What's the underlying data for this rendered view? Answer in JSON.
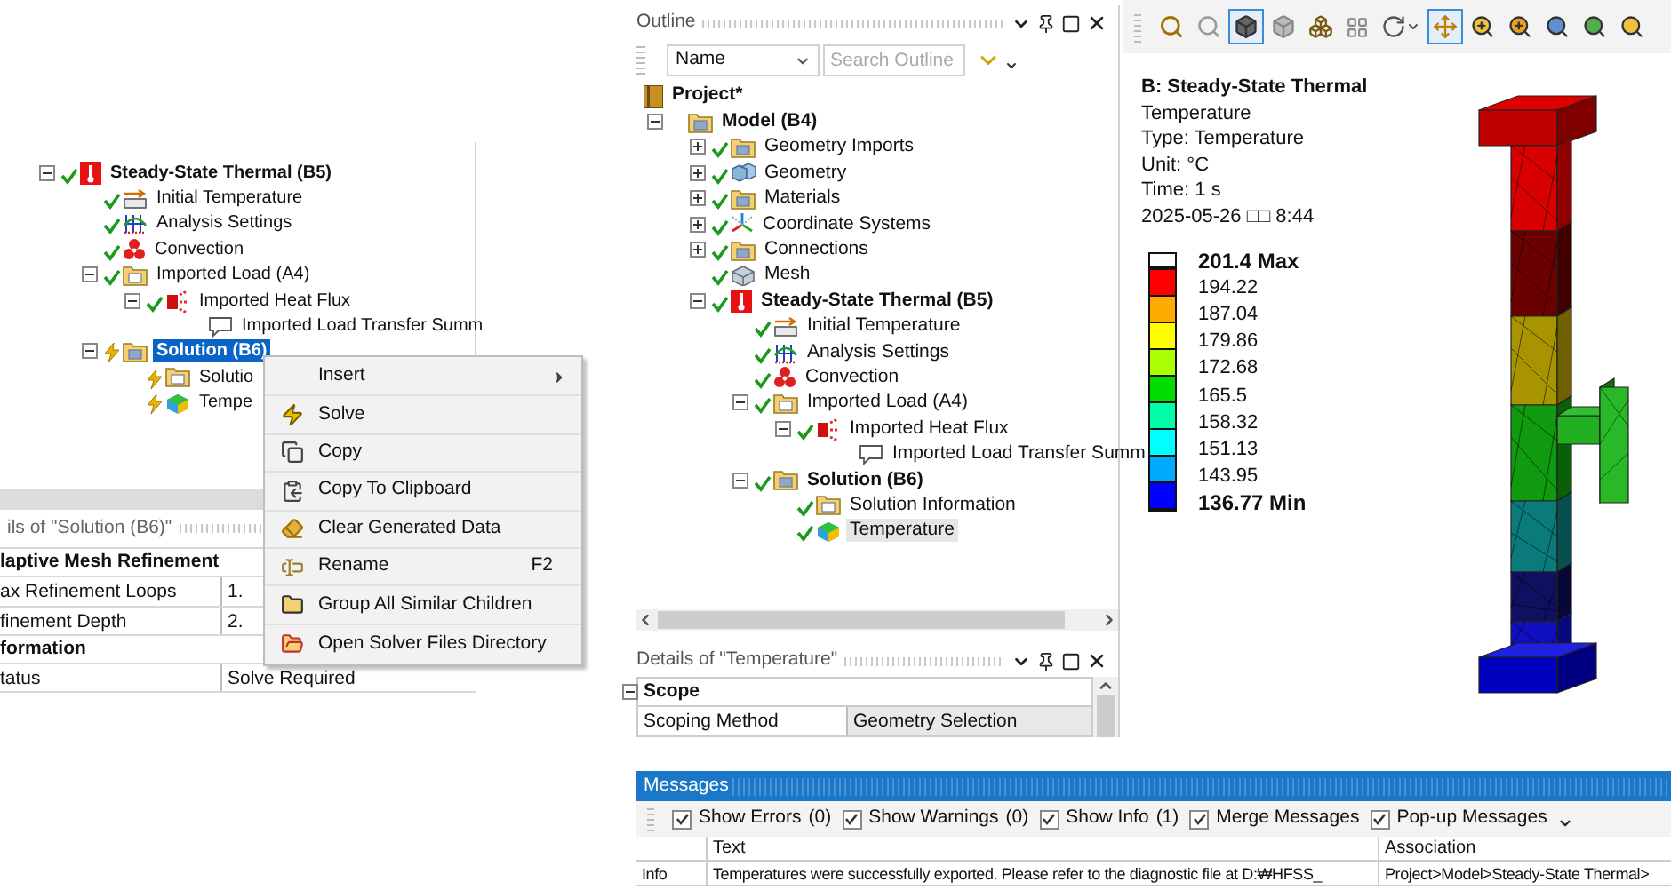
{
  "left_tree": {
    "items": [
      {
        "label": "Steady-State Thermal (B5)",
        "kind": "thermal",
        "solved": true,
        "expanded": true,
        "selected": false,
        "children": [
          {
            "label": "Initial Temperature",
            "kind": "initial-temperature",
            "solved": true,
            "selected": false
          },
          {
            "label": "Analysis Settings",
            "kind": "analysis-settings",
            "solved": true,
            "selected": false
          },
          {
            "label": "Convection",
            "kind": "convection",
            "solved": true,
            "selected": false
          },
          {
            "label": "Imported Load (A4)",
            "kind": "imported-load",
            "solved": true,
            "expanded": true,
            "selected": false,
            "children": [
              {
                "label": "Imported Heat Flux",
                "kind": "heat-flux",
                "solved": true,
                "expanded": true,
                "selected": false,
                "children": [
                  {
                    "label": "Imported Load Transfer Summ",
                    "kind": "transfer-summary",
                    "selected": false
                  }
                ]
              }
            ]
          },
          {
            "label": "Solution (B6)",
            "kind": "solution",
            "solved": false,
            "expanded": true,
            "selected": true,
            "children": [
              {
                "label": "Solutio",
                "kind": "solution-info",
                "solved": false,
                "selected": false
              },
              {
                "label": "Tempe",
                "kind": "temperature",
                "solved": false,
                "selected": false
              }
            ]
          }
        ]
      }
    ]
  },
  "left_details": {
    "title": "ils of \"Solution (B6)\"",
    "rows": [
      {
        "kind": "section",
        "label": "laptive Mesh Refinement"
      },
      {
        "kind": "field",
        "label": "ax Refinement Loops",
        "value": "1."
      },
      {
        "kind": "field",
        "label": "finement Depth",
        "value": "2."
      },
      {
        "kind": "section",
        "label": "formation"
      },
      {
        "kind": "field",
        "label": "tatus",
        "value": "Solve Required"
      }
    ]
  },
  "context_menu": {
    "items": [
      {
        "kind": "insert",
        "label": "Insert",
        "submenu": true
      },
      {
        "kind": "solve",
        "label": "Solve",
        "submenu": false
      },
      {
        "kind": "copy",
        "label": "Copy",
        "submenu": false
      },
      {
        "kind": "copy-clipboard",
        "label": "Copy To Clipboard",
        "submenu": false
      },
      {
        "kind": "clear",
        "label": "Clear Generated Data",
        "submenu": false
      },
      {
        "kind": "rename",
        "label": "Rename",
        "shortcut": "F2",
        "submenu": false
      },
      {
        "kind": "group",
        "label": "Group All Similar Children",
        "submenu": false
      },
      {
        "kind": "open-folder",
        "label": "Open Solver Files Directory",
        "submenu": false
      }
    ]
  },
  "outline": {
    "title": "Outline",
    "filter": {
      "value": "Name"
    },
    "search": {
      "placeholder": "Search Outline"
    },
    "tree": {
      "label": "Project*",
      "kind": "project",
      "selected": false,
      "children": [
        {
          "label": "Model (B4)",
          "kind": "model",
          "expanded": true,
          "selected": false,
          "children": [
            {
              "label": "Geometry Imports",
              "kind": "geometry-imports",
              "solved": true,
              "expanded": false,
              "selected": false
            },
            {
              "label": "Geometry",
              "kind": "geometry",
              "solved": true,
              "expanded": false,
              "selected": false
            },
            {
              "label": "Materials",
              "kind": "materials",
              "solved": true,
              "expanded": false,
              "selected": false
            },
            {
              "label": "Coordinate Systems",
              "kind": "coordinate-systems",
              "solved": true,
              "expanded": false,
              "selected": false
            },
            {
              "label": "Connections",
              "kind": "connections",
              "solved": true,
              "expanded": false,
              "selected": false
            },
            {
              "label": "Mesh",
              "kind": "mesh",
              "solved": true,
              "selected": false
            },
            {
              "label": "Steady-State Thermal (B5)",
              "kind": "thermal",
              "solved": true,
              "expanded": true,
              "selected": false,
              "children": [
                {
                  "label": "Initial Temperature",
                  "kind": "initial-temperature",
                  "solved": true,
                  "selected": false
                },
                {
                  "label": "Analysis Settings",
                  "kind": "analysis-settings",
                  "solved": true,
                  "selected": false
                },
                {
                  "label": "Convection",
                  "kind": "convection",
                  "solved": true,
                  "selected": false
                },
                {
                  "label": "Imported Load (A4)",
                  "kind": "imported-load",
                  "solved": true,
                  "expanded": true,
                  "selected": false,
                  "children": [
                    {
                      "label": "Imported Heat Flux",
                      "kind": "heat-flux",
                      "solved": true,
                      "expanded": true,
                      "selected": false,
                      "children": [
                        {
                          "label": "Imported Load Transfer Summ",
                          "kind": "transfer-summary",
                          "selected": false
                        }
                      ]
                    }
                  ]
                },
                {
                  "label": "Solution (B6)",
                  "kind": "solution",
                  "solved": true,
                  "expanded": true,
                  "selected": false,
                  "children": [
                    {
                      "label": "Solution Information",
                      "kind": "solution-info",
                      "solved": true,
                      "selected": false
                    },
                    {
                      "label": "Temperature",
                      "kind": "temperature",
                      "solved": true,
                      "selected": true
                    }
                  ]
                }
              ]
            }
          ]
        }
      ]
    }
  },
  "details": {
    "title": "Details of \"Temperature\"",
    "rows": [
      {
        "kind": "section",
        "label": "Scope",
        "expanded": true
      },
      {
        "kind": "field",
        "label": "Scoping Method",
        "value": "Geometry Selection"
      }
    ]
  },
  "viewport": {
    "toolbar": [
      {
        "kind": "previous-view",
        "selected": false
      },
      {
        "kind": "next-view",
        "selected": false
      },
      {
        "kind": "solid",
        "selected": true
      },
      {
        "kind": "shaded",
        "selected": false
      },
      {
        "kind": "wireframe",
        "selected": false
      },
      {
        "kind": "display-toggle",
        "selected": false
      },
      {
        "kind": "rotate",
        "selected": false
      },
      {
        "kind": "pan",
        "selected": true
      },
      {
        "kind": "zoom-in",
        "selected": false
      },
      {
        "kind": "zoom-box",
        "selected": false
      },
      {
        "kind": "fit",
        "selected": false
      },
      {
        "kind": "fit-selection",
        "selected": false
      },
      {
        "kind": "magnify",
        "selected": false
      }
    ],
    "title": "B: Steady-State Thermal",
    "info": [
      "Temperature",
      "Type: Temperature",
      "Unit: °C",
      "Time: 1 s",
      "2025-05-26 □□ 8:44"
    ],
    "legend": {
      "labels": [
        "201.4 Max",
        "194.22",
        "187.04",
        "179.86",
        "172.68",
        "165.5",
        "158.32",
        "151.13",
        "143.95",
        "136.77 Min"
      ],
      "bands": [
        {
          "color": "#ff0000"
        },
        {
          "color": "#ffaa00"
        },
        {
          "color": "#ffff00"
        },
        {
          "color": "#aaff00"
        },
        {
          "color": "#00dd00"
        },
        {
          "color": "#00ffaa"
        },
        {
          "color": "#00ffff"
        },
        {
          "color": "#00aaff"
        },
        {
          "color": "#0000ff"
        }
      ]
    }
  },
  "messages": {
    "title": "Messages",
    "filters": [
      {
        "label": "Show Errors",
        "count": "(0)",
        "checked": true
      },
      {
        "label": "Show Warnings",
        "count": "(0)",
        "checked": true
      },
      {
        "label": "Show Info",
        "count": "(1)",
        "checked": true
      },
      {
        "label": "Merge Messages",
        "checked": true
      },
      {
        "label": "Pop-up Messages",
        "checked": true
      }
    ],
    "columns": [
      "Text",
      "Association"
    ],
    "rows": [
      {
        "type": "Info",
        "text": "Temperatures were successfully exported. Please refer to the diagnostic file at D:₩HFSS_",
        "association": "Project>Model>Steady-State Thermal>"
      }
    ]
  }
}
